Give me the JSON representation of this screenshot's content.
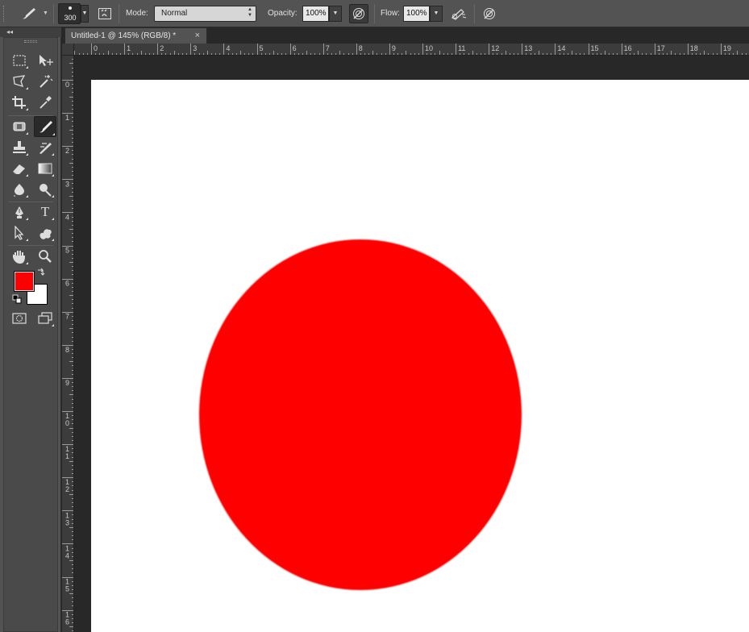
{
  "options_bar": {
    "brush_size": "300",
    "mode_label": "Mode:",
    "mode_value": "Normal",
    "opacity_label": "Opacity:",
    "opacity_value": "100%",
    "flow_label": "Flow:",
    "flow_value": "100%"
  },
  "document": {
    "tab_title": "Untitled-1 @ 145% (RGB/8) *",
    "close_glyph": "×"
  },
  "rulers": {
    "horizontal": [
      "0",
      "1",
      "2",
      "3",
      "4",
      "5",
      "6",
      "7",
      "8",
      "9",
      "10",
      "11",
      "12",
      "13",
      "14",
      "15",
      "16",
      "17",
      "18",
      "19"
    ],
    "vertical": [
      "0",
      "1",
      "2",
      "3",
      "4",
      "5",
      "6",
      "7",
      "8",
      "9",
      "10",
      "11",
      "12",
      "13",
      "14",
      "15",
      "16"
    ]
  },
  "colors": {
    "foreground": "#ff0000",
    "background": "#ffffff",
    "circle_fill": "#ff0000"
  },
  "tools": [
    {
      "name": "rectangular-marquee-tool",
      "icon": "marquee-icon"
    },
    {
      "name": "move-tool",
      "icon": "move-icon"
    },
    {
      "name": "lasso-tool",
      "icon": "lasso-icon"
    },
    {
      "name": "magic-wand-tool",
      "icon": "magic-wand-icon"
    },
    {
      "name": "crop-tool",
      "icon": "crop-icon"
    },
    {
      "name": "eyedropper-tool",
      "icon": "eyedropper-icon"
    },
    {
      "name": "spot-healing-tool",
      "icon": "healing-icon"
    },
    {
      "name": "brush-tool",
      "icon": "brush-icon",
      "active": true
    },
    {
      "name": "clone-stamp-tool",
      "icon": "stamp-icon"
    },
    {
      "name": "history-brush-tool",
      "icon": "history-brush-icon"
    },
    {
      "name": "eraser-tool",
      "icon": "eraser-icon"
    },
    {
      "name": "gradient-tool",
      "icon": "gradient-icon"
    },
    {
      "name": "blur-tool",
      "icon": "blur-icon"
    },
    {
      "name": "dodge-tool",
      "icon": "dodge-icon"
    },
    {
      "name": "pen-tool",
      "icon": "pen-icon"
    },
    {
      "name": "type-tool",
      "icon": "type-icon",
      "glyph": "T"
    },
    {
      "name": "path-selection-tool",
      "icon": "path-selection-icon"
    },
    {
      "name": "custom-shape-tool",
      "icon": "custom-shape-icon"
    },
    {
      "name": "hand-tool",
      "icon": "hand-icon"
    },
    {
      "name": "zoom-tool",
      "icon": "zoom-icon"
    }
  ]
}
